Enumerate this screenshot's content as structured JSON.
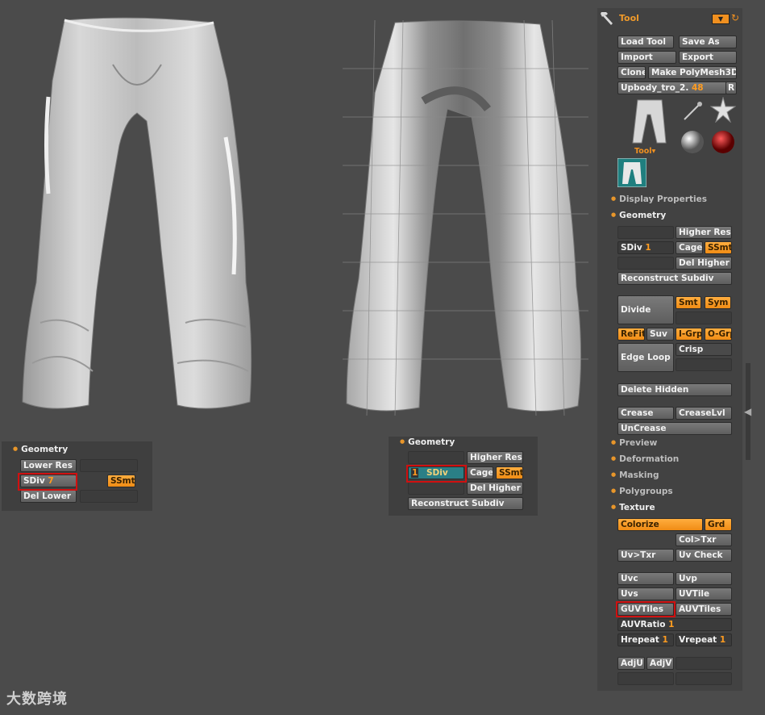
{
  "viewport": {
    "left_palette": {
      "title": "Geometry",
      "lower_res": "Lower Res",
      "sdiv_label": "SDiv",
      "sdiv_value": "7",
      "ssmt": "SSmt",
      "del_lower": "Del Lower"
    },
    "right_palette": {
      "title": "Geometry",
      "higher_res": "Higher Res",
      "sdiv_value": "1",
      "sdiv_label": "SDiv",
      "cage": "Cage",
      "ssmt": "SSmt",
      "del_higher": "Del Higher",
      "reconstruct": "Reconstruct Subdiv"
    }
  },
  "tool": {
    "title": "Tool",
    "load_tool": "Load Tool",
    "save_as": "Save As",
    "import": "Import",
    "export": "Export",
    "clone": "Clone",
    "make_polymesh": "Make PolyMesh3D",
    "current_tool": "Upbody_tro_2.",
    "current_tool_count": "48",
    "r_button": "R",
    "tool_thumb_label": "Tool",
    "display_properties": "Display Properties",
    "geometry": "Geometry",
    "higher_res": "Higher Res",
    "sdiv_label": "SDiv",
    "sdiv_value": "1",
    "cage": "Cage",
    "ssmt": "SSmt",
    "del_higher": "Del Higher",
    "reconstruct": "Reconstruct Subdiv",
    "divide": "Divide",
    "smt": "Smt",
    "sym": "Sym",
    "refit": "ReFit",
    "suv": "Suv",
    "igrp": "I-Grp",
    "ogrp": "O-Grp",
    "edge_loop": "Edge Loop",
    "crisp": "Crisp",
    "delete_hidden": "Delete Hidden",
    "crease": "Crease",
    "creaselvl": "CreaseLvl",
    "uncrease": "UnCrease",
    "preview": "Preview",
    "deformation": "Deformation",
    "masking": "Masking",
    "polygroups": "Polygroups",
    "texture": "Texture",
    "colorize": "Colorize",
    "grd": "Grd",
    "col_txr": "Col>Txr",
    "uv_txr": "Uv>Txr",
    "uv_check": "Uv Check",
    "uvc": "Uvc",
    "uvp": "Uvp",
    "uvs": "Uvs",
    "uvtile": "UVTile",
    "guvtiles": "GUVTiles",
    "auvtiles": "AUVTiles",
    "auvratio_label": "AUVRatio",
    "auvratio_value": "1",
    "hrepeat_label": "Hrepeat",
    "hrepeat_value": "1",
    "vrepeat_label": "Vrepeat",
    "vrepeat_value": "1",
    "adju": "AdjU",
    "adjv": "AdjV"
  },
  "watermark": "大数跨境",
  "colors": {
    "accent": "#f09020",
    "highlight": "#d01010",
    "sdiv_teal": "#2a7f86"
  }
}
